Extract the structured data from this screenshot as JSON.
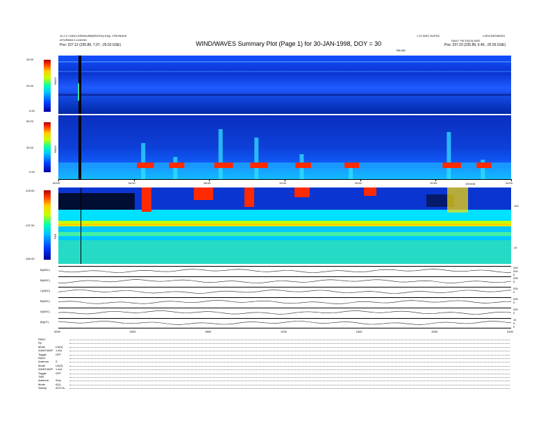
{
  "header": {
    "left_line1": "11-0.2 / MDCLDISHNUMB(RDDSD) Ehly: JTRONUKE",
    "left_line2": "ATS/RM03.3  ±13/03/1",
    "left_line3": "Pos:  237.12 (235.89, 7.07, -25.53 GSE)",
    "title": "WIND/WAVES Summary Plot (Page 1) for 30-JAN-1998, DOY = 30",
    "center_right": "1.10 WSC DUPDC",
    "right_line1": "LXR/CDROM/S01",
    "right_line2": "DAILY TM 2S(10),3002",
    "right_line3": "Pos:  237.23 (235.89, 6.40, -25.55 GSE)",
    "right_line3b": "TBLINE"
  },
  "colors": {
    "background": "#0a2fbf",
    "band": "#1e5bff",
    "red": "#ff2a00",
    "yellow": "#ffe000",
    "cyan": "#00d8ff",
    "green": "#7dff3a"
  },
  "chart_data": [
    {
      "type": "heatmap",
      "name": "RAD2",
      "ylabel": "RAD2",
      "cbar_ticks": [
        "40.00",
        "20.00",
        "0.00"
      ],
      "marker_label": "Cal",
      "xlim_hours": [
        0,
        24
      ]
    },
    {
      "type": "heatmap",
      "name": "RAD1",
      "ylabel": "RAD1",
      "cbar_ticks": [
        "50.00",
        "30.00",
        "0.00"
      ],
      "xticks": [
        "00:00",
        "04:00",
        "08:00",
        "12:00",
        "16:00",
        "20:00",
        "24:00"
      ],
      "annotation": "10m/x/d",
      "bursts": [
        {
          "t": 4.5,
          "level": 0.65
        },
        {
          "t": 6.2,
          "level": 0.4
        },
        {
          "t": 8.6,
          "level": 0.9
        },
        {
          "t": 10.5,
          "level": 0.75
        },
        {
          "t": 12.9,
          "level": 0.45
        },
        {
          "t": 15.5,
          "level": 0.3
        },
        {
          "t": 20.7,
          "level": 0.85
        },
        {
          "t": 22.5,
          "level": 0.35
        }
      ]
    },
    {
      "type": "heatmap",
      "name": "TNR",
      "ylabel": "TNR",
      "cbar_ticks": [
        "-125.00",
        "-137.50",
        "-150.00"
      ],
      "right_ticks": [
        "100",
        "10"
      ]
    },
    {
      "type": "line",
      "name": "housekeeping",
      "series": [
        {
          "name": "B(ADC)",
          "right": [
            "200",
            "200",
            "0"
          ]
        },
        {
          "name": "B(ADC)",
          "right": [
            "200",
            "0"
          ]
        },
        {
          "name": "C(ADC)",
          "right": [
            "200",
            "0"
          ]
        },
        {
          "name": "B(ADC)",
          "right": [
            "200",
            "0"
          ]
        },
        {
          "name": "A(ADC)",
          "right": [
            "200",
            "0"
          ]
        },
        {
          "name": "|B|(nT)",
          "right": [
            "10",
            "5",
            "0"
          ]
        }
      ],
      "xticks": [
        "0000",
        "0400",
        "0800",
        "1200",
        "1600",
        "2000",
        "2400"
      ]
    }
  ],
  "status": {
    "rows": [
      {
        "label": "RAD1",
        "value": ""
      },
      {
        "label": "Sp",
        "value": ""
      },
      {
        "label": "Mode",
        "value": "LN(S)"
      },
      {
        "label": "S/ANT/ADP",
        "value": "1 Ant"
      },
      {
        "label": "Toggle",
        "value": "OFF"
      },
      {
        "label": "RAD1",
        "value": ""
      },
      {
        "label": "Antenna",
        "value": "S"
      },
      {
        "label": "Mode",
        "value": "LN(S)"
      },
      {
        "label": "S/ANT/ADP",
        "value": "1 Ant"
      },
      {
        "label": "Toggle",
        "value": "OFF"
      },
      {
        "label": "TNR",
        "value": ""
      },
      {
        "label": "Antenna",
        "value": "Sx/y"
      },
      {
        "label": "Mode",
        "value": "A(1)"
      },
      {
        "label": "Sweep",
        "value": "ACCOL"
      }
    ]
  }
}
